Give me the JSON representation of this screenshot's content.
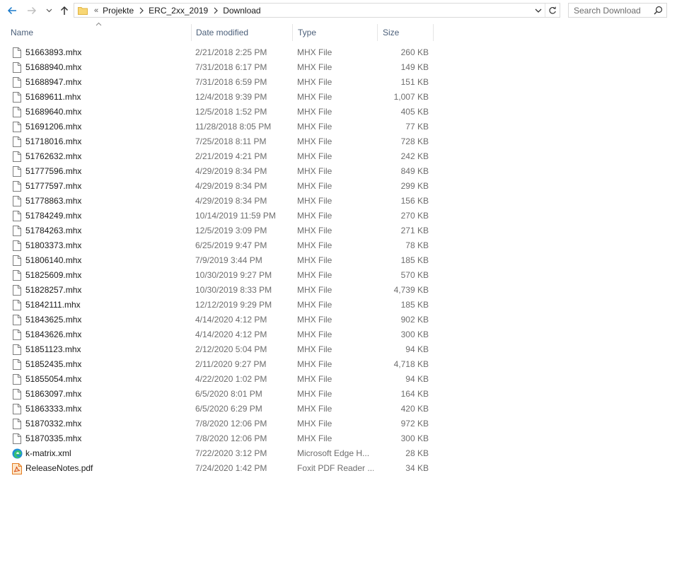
{
  "nav": {
    "back_icon": "arrow-left-icon",
    "forward_icon": "arrow-right-icon",
    "recent_icon": "chevron-down-icon",
    "up_icon": "arrow-up-icon",
    "accent": "#1979ca"
  },
  "address": {
    "folder_icon": "folder-icon",
    "overflow": "«",
    "crumbs": [
      "Projekte",
      "ERC_2xx_2019",
      "Download"
    ]
  },
  "search": {
    "placeholder": "Search Download"
  },
  "columns": {
    "name": "Name",
    "date": "Date modified",
    "type": "Type",
    "size": "Size"
  },
  "files": [
    {
      "name": "51663893.mhx",
      "date": "2/21/2018 2:25 PM",
      "type": "MHX File",
      "size": "260 KB",
      "icon": "file-icon"
    },
    {
      "name": "51688940.mhx",
      "date": "7/31/2018 6:17 PM",
      "type": "MHX File",
      "size": "149 KB",
      "icon": "file-icon"
    },
    {
      "name": "51688947.mhx",
      "date": "7/31/2018 6:59 PM",
      "type": "MHX File",
      "size": "151 KB",
      "icon": "file-icon"
    },
    {
      "name": "51689611.mhx",
      "date": "12/4/2018 9:39 PM",
      "type": "MHX File",
      "size": "1,007 KB",
      "icon": "file-icon"
    },
    {
      "name": "51689640.mhx",
      "date": "12/5/2018 1:52 PM",
      "type": "MHX File",
      "size": "405 KB",
      "icon": "file-icon"
    },
    {
      "name": "51691206.mhx",
      "date": "11/28/2018 8:05 PM",
      "type": "MHX File",
      "size": "77 KB",
      "icon": "file-icon"
    },
    {
      "name": "51718016.mhx",
      "date": "7/25/2018 8:11 PM",
      "type": "MHX File",
      "size": "728 KB",
      "icon": "file-icon"
    },
    {
      "name": "51762632.mhx",
      "date": "2/21/2019 4:21 PM",
      "type": "MHX File",
      "size": "242 KB",
      "icon": "file-icon"
    },
    {
      "name": "51777596.mhx",
      "date": "4/29/2019 8:34 PM",
      "type": "MHX File",
      "size": "849 KB",
      "icon": "file-icon"
    },
    {
      "name": "51777597.mhx",
      "date": "4/29/2019 8:34 PM",
      "type": "MHX File",
      "size": "299 KB",
      "icon": "file-icon"
    },
    {
      "name": "51778863.mhx",
      "date": "4/29/2019 8:34 PM",
      "type": "MHX File",
      "size": "156 KB",
      "icon": "file-icon"
    },
    {
      "name": "51784249.mhx",
      "date": "10/14/2019 11:59 PM",
      "type": "MHX File",
      "size": "270 KB",
      "icon": "file-icon"
    },
    {
      "name": "51784263.mhx",
      "date": "12/5/2019 3:09 PM",
      "type": "MHX File",
      "size": "271 KB",
      "icon": "file-icon"
    },
    {
      "name": "51803373.mhx",
      "date": "6/25/2019 9:47 PM",
      "type": "MHX File",
      "size": "78 KB",
      "icon": "file-icon"
    },
    {
      "name": "51806140.mhx",
      "date": "7/9/2019 3:44 PM",
      "type": "MHX File",
      "size": "185 KB",
      "icon": "file-icon"
    },
    {
      "name": "51825609.mhx",
      "date": "10/30/2019 9:27 PM",
      "type": "MHX File",
      "size": "570 KB",
      "icon": "file-icon"
    },
    {
      "name": "51828257.mhx",
      "date": "10/30/2019 8:33 PM",
      "type": "MHX File",
      "size": "4,739 KB",
      "icon": "file-icon"
    },
    {
      "name": "51842111.mhx",
      "date": "12/12/2019 9:29 PM",
      "type": "MHX File",
      "size": "185 KB",
      "icon": "file-icon"
    },
    {
      "name": "51843625.mhx",
      "date": "4/14/2020 4:12 PM",
      "type": "MHX File",
      "size": "902 KB",
      "icon": "file-icon"
    },
    {
      "name": "51843626.mhx",
      "date": "4/14/2020 4:12 PM",
      "type": "MHX File",
      "size": "300 KB",
      "icon": "file-icon"
    },
    {
      "name": "51851123.mhx",
      "date": "2/12/2020 5:04 PM",
      "type": "MHX File",
      "size": "94 KB",
      "icon": "file-icon"
    },
    {
      "name": "51852435.mhx",
      "date": "2/11/2020 9:27 PM",
      "type": "MHX File",
      "size": "4,718 KB",
      "icon": "file-icon"
    },
    {
      "name": "51855054.mhx",
      "date": "4/22/2020 1:02 PM",
      "type": "MHX File",
      "size": "94 KB",
      "icon": "file-icon"
    },
    {
      "name": "51863097.mhx",
      "date": "6/5/2020 8:01 PM",
      "type": "MHX File",
      "size": "164 KB",
      "icon": "file-icon"
    },
    {
      "name": "51863333.mhx",
      "date": "6/5/2020 6:29 PM",
      "type": "MHX File",
      "size": "420 KB",
      "icon": "file-icon"
    },
    {
      "name": "51870332.mhx",
      "date": "7/8/2020 12:06 PM",
      "type": "MHX File",
      "size": "972 KB",
      "icon": "file-icon"
    },
    {
      "name": "51870335.mhx",
      "date": "7/8/2020 12:06 PM",
      "type": "MHX File",
      "size": "300 KB",
      "icon": "file-icon"
    },
    {
      "name": "k-matrix.xml",
      "date": "7/22/2020 3:12 PM",
      "type": "Microsoft Edge H...",
      "size": "28 KB",
      "icon": "edge-icon"
    },
    {
      "name": "ReleaseNotes.pdf",
      "date": "7/24/2020 1:42 PM",
      "type": "Foxit PDF Reader ...",
      "size": "34 KB",
      "icon": "pdf-icon"
    }
  ]
}
